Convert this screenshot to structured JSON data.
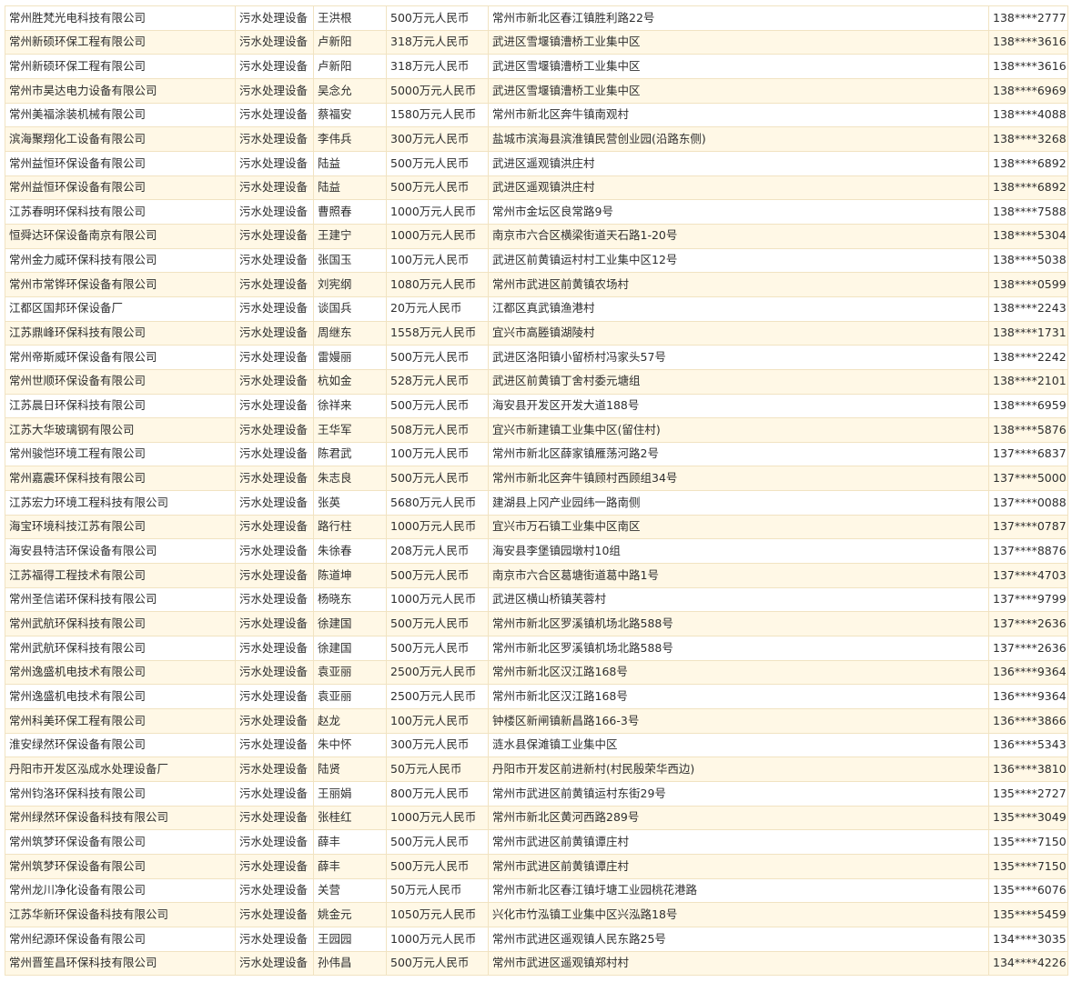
{
  "rows": [
    [
      "常州胜梵光电科技有限公司",
      "污水处理设备",
      "王洪根",
      "500万元人民币",
      "常州市新北区春江镇胜利路22号",
      "138****2777"
    ],
    [
      "常州新硕环保工程有限公司",
      "污水处理设备",
      "卢新阳",
      "318万元人民币",
      "武进区雪堰镇漕桥工业集中区",
      "138****3616"
    ],
    [
      "常州新硕环保工程有限公司",
      "污水处理设备",
      "卢新阳",
      "318万元人民币",
      "武进区雪堰镇漕桥工业集中区",
      "138****3616"
    ],
    [
      "常州市昊达电力设备有限公司",
      "污水处理设备",
      "吴念允",
      "5000万元人民币",
      "武进区雪堰镇漕桥工业集中区",
      "138****6969"
    ],
    [
      "常州美福涂装机械有限公司",
      "污水处理设备",
      "蔡福安",
      "1580万元人民币",
      "常州市新北区奔牛镇南观村",
      "138****4088"
    ],
    [
      "滨海聚翔化工设备有限公司",
      "污水处理设备",
      "李伟兵",
      "300万元人民币",
      "盐城市滨海县滨淮镇民营创业园(沿路东侧)",
      "138****3268"
    ],
    [
      "常州益恒环保设备有限公司",
      "污水处理设备",
      "陆益",
      "500万元人民币",
      "武进区遥观镇洪庄村",
      "138****6892"
    ],
    [
      "常州益恒环保设备有限公司",
      "污水处理设备",
      "陆益",
      "500万元人民币",
      "武进区遥观镇洪庄村",
      "138****6892"
    ],
    [
      "江苏春明环保科技有限公司",
      "污水处理设备",
      "曹照春",
      "1000万元人民币",
      "常州市金坛区良常路9号",
      "138****7588"
    ],
    [
      "恒舜达环保设备南京有限公司",
      "污水处理设备",
      "王建宁",
      "1000万元人民币",
      "南京市六合区横梁街道天石路1-20号",
      "138****5304"
    ],
    [
      "常州金力威环保科技有限公司",
      "污水处理设备",
      "张国玉",
      "100万元人民币",
      "武进区前黄镇运村村工业集中区12号",
      "138****5038"
    ],
    [
      "常州市常铧环保设备有限公司",
      "污水处理设备",
      "刘宪纲",
      "1080万元人民币",
      "常州市武进区前黄镇农场村",
      "138****0599"
    ],
    [
      "江都区国邦环保设备厂",
      "污水处理设备",
      "谈国兵",
      "20万元人民币",
      "江都区真武镇渔港村",
      "138****2243"
    ],
    [
      "江苏鼎峰环保科技有限公司",
      "污水处理设备",
      "周继东",
      "1558万元人民币",
      "宜兴市高塍镇湖陵村",
      "138****1731"
    ],
    [
      "常州帝斯威环保设备有限公司",
      "污水处理设备",
      "雷嫚丽",
      "500万元人民币",
      "武进区洛阳镇小留桥村冯家头57号",
      "138****2242"
    ],
    [
      "常州世顺环保设备有限公司",
      "污水处理设备",
      "杭如金",
      "528万元人民币",
      "武进区前黄镇丁舍村委元塘组",
      "138****2101"
    ],
    [
      "江苏晨日环保科技有限公司",
      "污水处理设备",
      "徐祥来",
      "500万元人民币",
      "海安县开发区开发大道188号",
      "138****6959"
    ],
    [
      "江苏大华玻璃钢有限公司",
      "污水处理设备",
      "王华军",
      "508万元人民币",
      "宜兴市新建镇工业集中区(留住村)",
      "138****5876"
    ],
    [
      "常州骏恺环境工程有限公司",
      "污水处理设备",
      "陈君武",
      "100万元人民币",
      "常州市新北区薛家镇雁荡河路2号",
      "137****6837"
    ],
    [
      "常州嘉震环保科技有限公司",
      "污水处理设备",
      "朱志良",
      "500万元人民币",
      "常州市新北区奔牛镇顾村西顾组34号",
      "137****5000"
    ],
    [
      "江苏宏力环境工程科技有限公司",
      "污水处理设备",
      "张英",
      "5680万元人民币",
      "建湖县上冈产业园纬一路南侧",
      "137****0088"
    ],
    [
      "海宝环境科技江苏有限公司",
      "污水处理设备",
      "路行柱",
      "1000万元人民币",
      "宜兴市万石镇工业集中区南区",
      "137****0787"
    ],
    [
      "海安县特洁环保设备有限公司",
      "污水处理设备",
      "朱徐春",
      "208万元人民币",
      "海安县李堡镇园墩村10组",
      "137****8876"
    ],
    [
      "江苏福得工程技术有限公司",
      "污水处理设备",
      "陈道坤",
      "500万元人民币",
      "南京市六合区葛塘街道葛中路1号",
      "137****4703"
    ],
    [
      "常州圣信诺环保科技有限公司",
      "污水处理设备",
      "杨晓东",
      "1000万元人民币",
      "武进区横山桥镇芙蓉村",
      "137****9799"
    ],
    [
      "常州武航环保科技有限公司",
      "污水处理设备",
      "徐建国",
      "500万元人民币",
      "常州市新北区罗溪镇机场北路588号",
      "137****2636"
    ],
    [
      "常州武航环保科技有限公司",
      "污水处理设备",
      "徐建国",
      "500万元人民币",
      "常州市新北区罗溪镇机场北路588号",
      "137****2636"
    ],
    [
      "常州逸盛机电技术有限公司",
      "污水处理设备",
      "袁亚丽",
      "2500万元人民币",
      "常州市新北区汉江路168号",
      "136****9364"
    ],
    [
      "常州逸盛机电技术有限公司",
      "污水处理设备",
      "袁亚丽",
      "2500万元人民币",
      "常州市新北区汉江路168号",
      "136****9364"
    ],
    [
      "常州科美环保工程有限公司",
      "污水处理设备",
      "赵龙",
      "100万元人民币",
      "钟楼区新闸镇新昌路166-3号",
      "136****3866"
    ],
    [
      "淮安绿然环保设备有限公司",
      "污水处理设备",
      "朱中怀",
      "300万元人民币",
      "涟水县保滩镇工业集中区",
      "136****5343"
    ],
    [
      "丹阳市开发区泓成水处理设备厂",
      "污水处理设备",
      "陆贤",
      "50万元人民币",
      "丹阳市开发区前进新村(村民殷荣华西边)",
      "136****3810"
    ],
    [
      "常州钧洛环保科技有限公司",
      "污水处理设备",
      "王丽娟",
      "800万元人民币",
      "常州市武进区前黄镇运村东街29号",
      "135****2727"
    ],
    [
      "常州绿然环保设备科技有限公司",
      "污水处理设备",
      "张桂红",
      "1000万元人民币",
      "常州市新北区黄河西路289号",
      "135****3049"
    ],
    [
      "常州筑梦环保设备有限公司",
      "污水处理设备",
      "薛丰",
      "500万元人民币",
      "常州市武进区前黄镇谭庄村",
      "135****7150"
    ],
    [
      "常州筑梦环保设备有限公司",
      "污水处理设备",
      "薛丰",
      "500万元人民币",
      "常州市武进区前黄镇谭庄村",
      "135****7150"
    ],
    [
      "常州龙川净化设备有限公司",
      "污水处理设备",
      "关营",
      "50万元人民币",
      "常州市新北区春江镇圩塘工业园桃花港路",
      "135****6076"
    ],
    [
      "江苏华新环保设备科技有限公司",
      "污水处理设备",
      "姚金元",
      "1050万元人民币",
      "兴化市竹泓镇工业集中区兴泓路18号",
      "135****5459"
    ],
    [
      "常州纪源环保设备有限公司",
      "污水处理设备",
      "王园园",
      "1000万元人民币",
      "常州市武进区遥观镇人民东路25号",
      "134****3035"
    ],
    [
      "常州晋笙昌环保科技有限公司",
      "污水处理设备",
      "孙伟昌",
      "500万元人民币",
      "常州市武进区遥观镇郑村村",
      "134****4226"
    ]
  ]
}
